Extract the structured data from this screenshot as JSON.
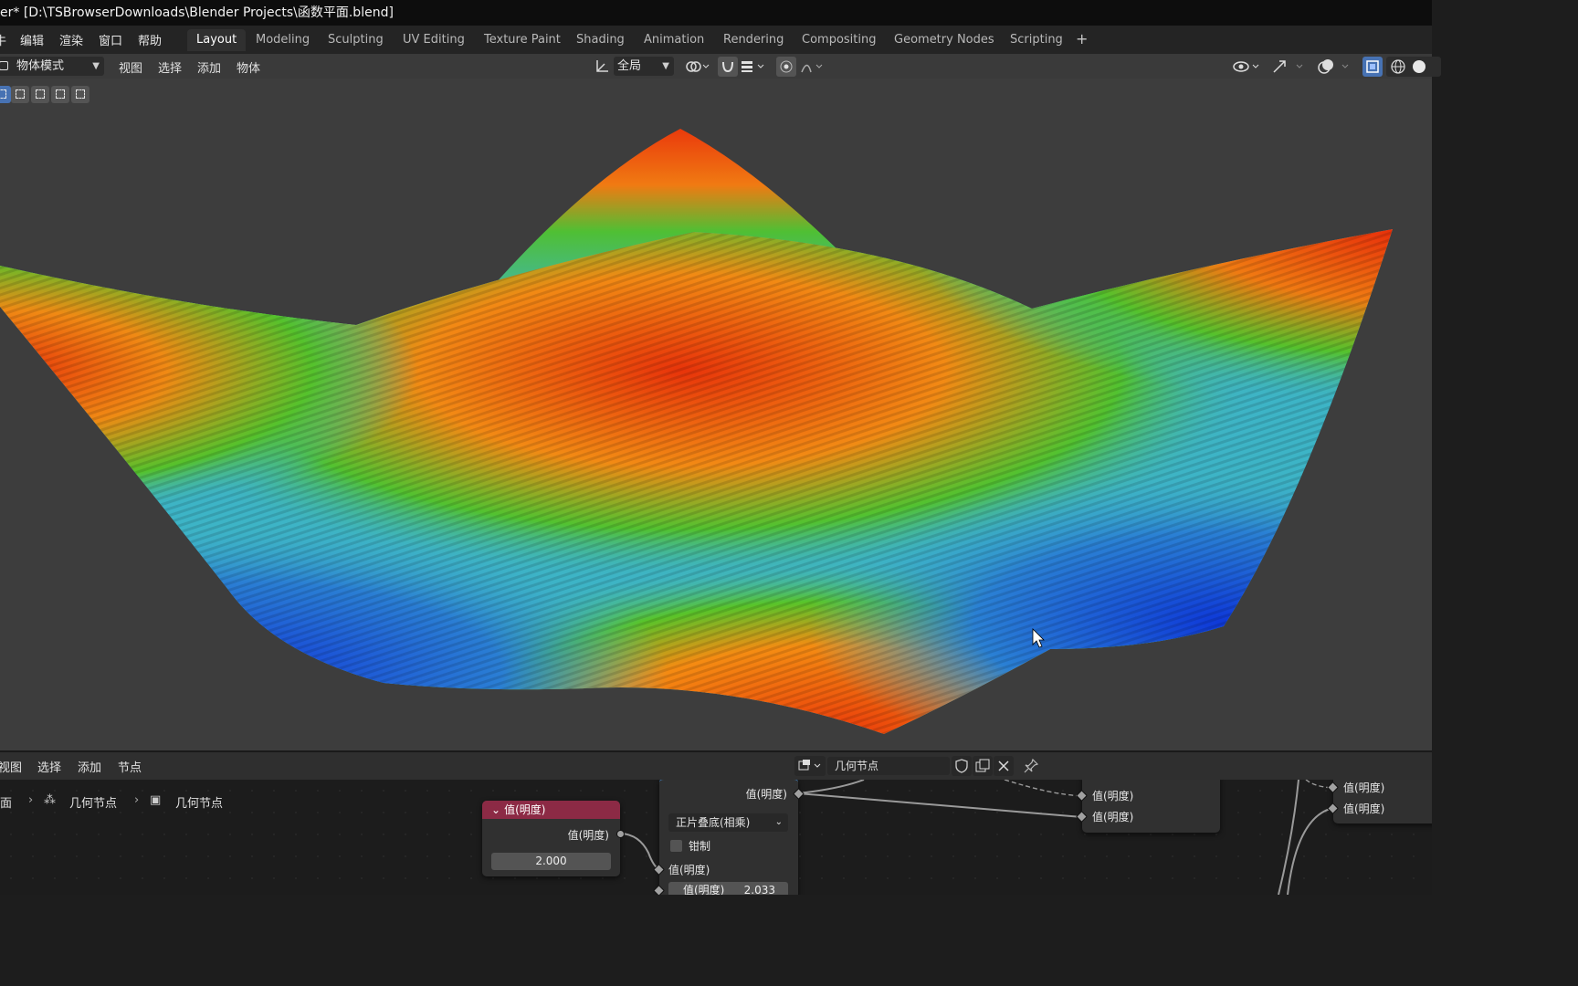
{
  "titlebar": {
    "text": "er* [D:\\TSBrowserDownloads\\Blender Projects\\函数平面.blend]"
  },
  "menubar": {
    "menus": [
      "牛",
      "编辑",
      "渲染",
      "窗口",
      "帮助"
    ],
    "workspaces": [
      "Layout",
      "Modeling",
      "Sculpting",
      "UV Editing",
      "Texture Paint",
      "Shading",
      "Animation",
      "Rendering",
      "Compositing",
      "Geometry Nodes",
      "Scripting"
    ],
    "active_workspace": "Layout",
    "add_tab": "+"
  },
  "viewport_header": {
    "mode": "物体模式",
    "menus": [
      "视图",
      "选择",
      "添加",
      "物体"
    ],
    "transform_orientation": "全局",
    "icons": [
      "orientation-icon",
      "pivot-icon",
      "snap-icon",
      "snap-increment-icon",
      "proportional-edit-icon",
      "falloff-icon",
      "visibility-icon",
      "gizmo-icon",
      "overlay-icon",
      "xray-icon",
      "wireframe-shading-icon",
      "solid-shading-icon"
    ]
  },
  "viewport": {
    "background": "#3d3d3d",
    "surface_palette": [
      "#0a2fd8",
      "#2c8fd6",
      "#3fb7c6",
      "#49c23a",
      "#e3c51a",
      "#f06a10",
      "#e8300a"
    ]
  },
  "node_editor": {
    "menus": [
      "视图",
      "选择",
      "添加",
      "节点"
    ],
    "tree_name": "几何节点",
    "breadcrumb": [
      "面",
      "几何节点",
      "几何节点"
    ],
    "nodes": {
      "value_node": {
        "title": "值(明度)",
        "output_label": "值(明度)",
        "value": "2.000",
        "header_color": "#8c2a45"
      },
      "math_node": {
        "output_label": "值(明度)",
        "blend_mode": "正片叠底(相乘)",
        "clamp_label": "钳制",
        "input_label": "值(明度)",
        "field_label": "值(明度)",
        "field_value": "2.033"
      },
      "right_node": {
        "inputs": [
          "值(明度)",
          "值(明度)"
        ]
      },
      "far_node": {
        "inputs": [
          "值(明度)",
          "值(明度)"
        ]
      }
    }
  }
}
